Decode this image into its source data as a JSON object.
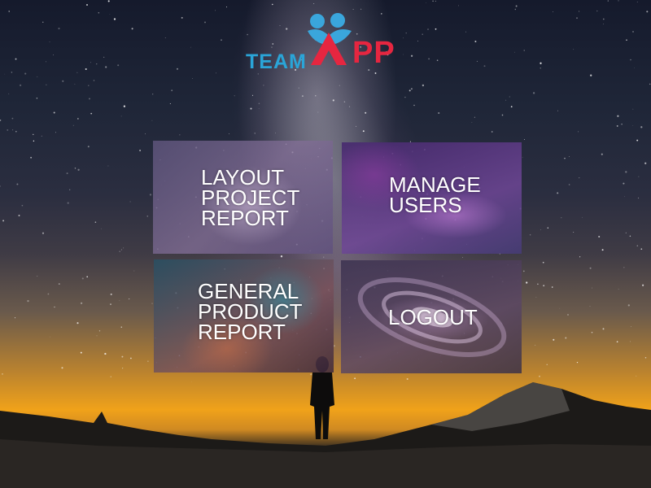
{
  "app": {
    "logo_word_team": "TEAM",
    "logo_word_pp": "PP",
    "brand_colors": {
      "team": "#2aa5d8",
      "mark_blue": "#3aa6dc",
      "mark_red": "#e62640"
    }
  },
  "menu": {
    "tiles": [
      {
        "id": "layout-project-report",
        "label": "LAYOUT\nPROJECT\nREPORT"
      },
      {
        "id": "manage-users",
        "label": "MANAGE\nUSERS"
      },
      {
        "id": "general-product-report",
        "label": "GENERAL\nPRODUCT\nREPORT"
      },
      {
        "id": "logout",
        "label": "LOGOUT"
      }
    ]
  }
}
